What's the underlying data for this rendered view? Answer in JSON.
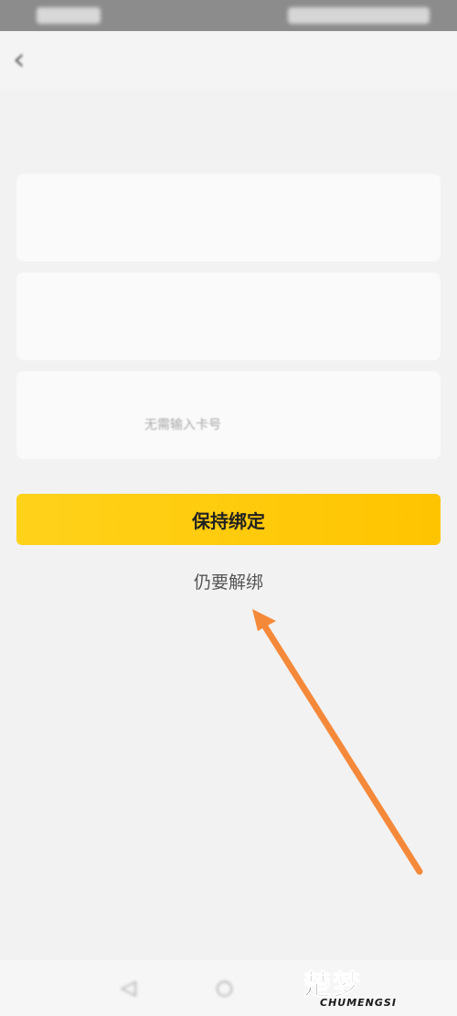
{
  "status_bar": {
    "left_text": "",
    "right_text": ""
  },
  "header": {
    "back_icon": "chevron-left-icon",
    "title": ""
  },
  "question": {
    "text": ""
  },
  "cards": [
    {
      "title": "",
      "subtitle": "",
      "tag": ""
    },
    {
      "title": "",
      "subtitle": "",
      "tag": ""
    },
    {
      "title": "",
      "subtitle": "无需输入卡号",
      "tag": ""
    }
  ],
  "actions": {
    "keep_label": "保持绑定",
    "unbind_label": "仍要解绑"
  },
  "footnote": {
    "text": ""
  },
  "watermark": {
    "main": "楚梦",
    "sub": "CHUMENGSI"
  },
  "colors": {
    "primary_button": "#ffc400",
    "tag_accent": "#f2a23a",
    "annotation_arrow": "#f5893a"
  }
}
